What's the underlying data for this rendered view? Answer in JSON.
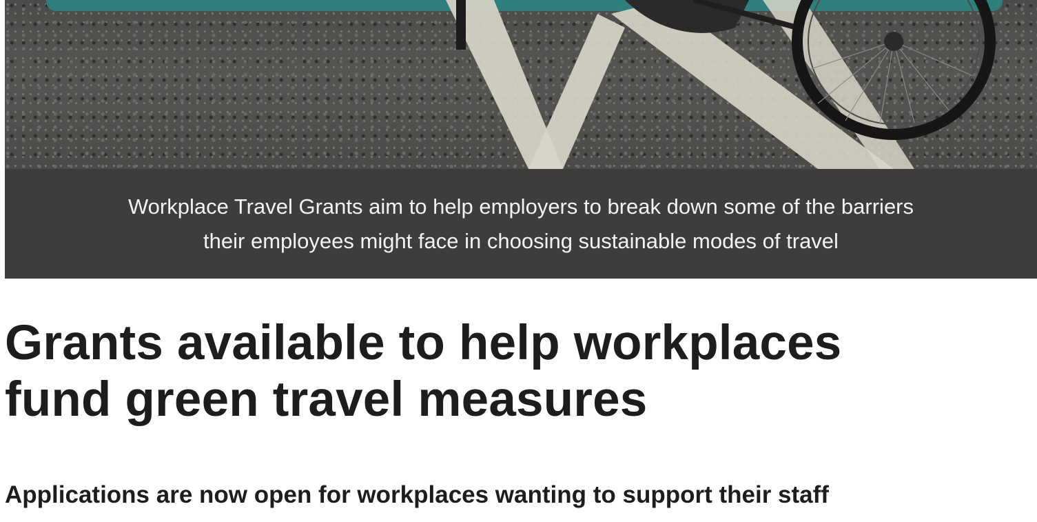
{
  "hero": {
    "image_icon": "parked-bicycle-photo",
    "accent_color": "#2f7f7d"
  },
  "caption": {
    "line1": "Workplace Travel Grants aim to help employers to break down some of the barriers",
    "line2": "their employees might face in choosing sustainable modes of travel"
  },
  "article": {
    "title_line1": "Grants available to help workplaces",
    "title_line2": "fund green travel measures",
    "standfirst": "Applications are now open for workplaces wanting to support their staff"
  }
}
